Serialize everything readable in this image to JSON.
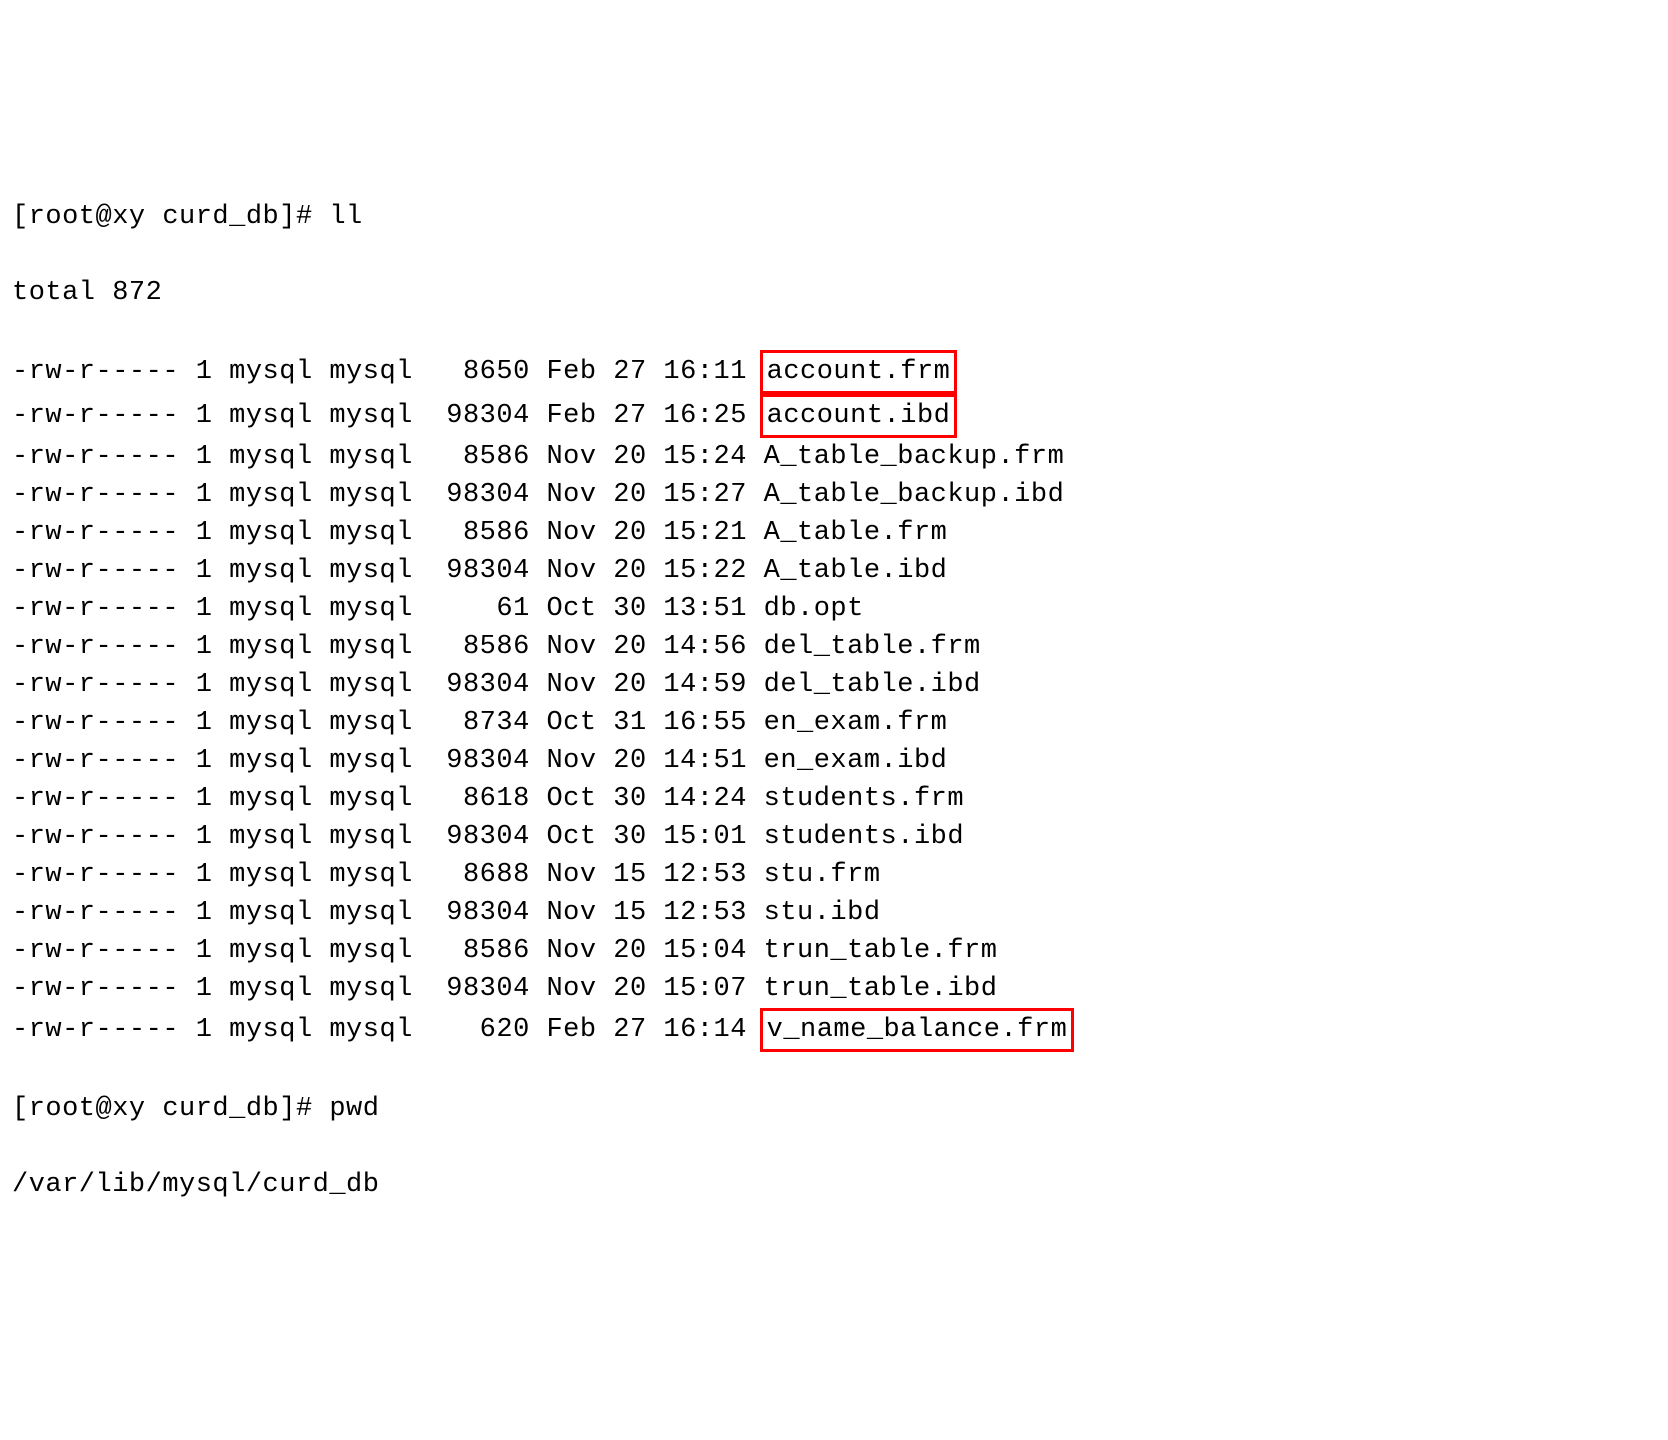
{
  "prompt1": "[root@xy curd_db]# ",
  "cmd1": "ll",
  "total_line": "total 872",
  "files": [
    {
      "perms": "-rw-r-----",
      "links": "1",
      "owner": "mysql",
      "group": "mysql",
      "size": "  8650",
      "date": "Feb 27 16:11",
      "name": "account.frm",
      "highlight": true
    },
    {
      "perms": "-rw-r-----",
      "links": "1",
      "owner": "mysql",
      "group": "mysql",
      "size": " 98304",
      "date": "Feb 27 16:25",
      "name": "account.ibd",
      "highlight": true
    },
    {
      "perms": "-rw-r-----",
      "links": "1",
      "owner": "mysql",
      "group": "mysql",
      "size": "  8586",
      "date": "Nov 20 15:24",
      "name": "A_table_backup.frm",
      "highlight": false
    },
    {
      "perms": "-rw-r-----",
      "links": "1",
      "owner": "mysql",
      "group": "mysql",
      "size": " 98304",
      "date": "Nov 20 15:27",
      "name": "A_table_backup.ibd",
      "highlight": false
    },
    {
      "perms": "-rw-r-----",
      "links": "1",
      "owner": "mysql",
      "group": "mysql",
      "size": "  8586",
      "date": "Nov 20 15:21",
      "name": "A_table.frm",
      "highlight": false
    },
    {
      "perms": "-rw-r-----",
      "links": "1",
      "owner": "mysql",
      "group": "mysql",
      "size": " 98304",
      "date": "Nov 20 15:22",
      "name": "A_table.ibd",
      "highlight": false
    },
    {
      "perms": "-rw-r-----",
      "links": "1",
      "owner": "mysql",
      "group": "mysql",
      "size": "    61",
      "date": "Oct 30 13:51",
      "name": "db.opt",
      "highlight": false
    },
    {
      "perms": "-rw-r-----",
      "links": "1",
      "owner": "mysql",
      "group": "mysql",
      "size": "  8586",
      "date": "Nov 20 14:56",
      "name": "del_table.frm",
      "highlight": false
    },
    {
      "perms": "-rw-r-----",
      "links": "1",
      "owner": "mysql",
      "group": "mysql",
      "size": " 98304",
      "date": "Nov 20 14:59",
      "name": "del_table.ibd",
      "highlight": false
    },
    {
      "perms": "-rw-r-----",
      "links": "1",
      "owner": "mysql",
      "group": "mysql",
      "size": "  8734",
      "date": "Oct 31 16:55",
      "name": "en_exam.frm",
      "highlight": false
    },
    {
      "perms": "-rw-r-----",
      "links": "1",
      "owner": "mysql",
      "group": "mysql",
      "size": " 98304",
      "date": "Nov 20 14:51",
      "name": "en_exam.ibd",
      "highlight": false
    },
    {
      "perms": "-rw-r-----",
      "links": "1",
      "owner": "mysql",
      "group": "mysql",
      "size": "  8618",
      "date": "Oct 30 14:24",
      "name": "students.frm",
      "highlight": false
    },
    {
      "perms": "-rw-r-----",
      "links": "1",
      "owner": "mysql",
      "group": "mysql",
      "size": " 98304",
      "date": "Oct 30 15:01",
      "name": "students.ibd",
      "highlight": false
    },
    {
      "perms": "-rw-r-----",
      "links": "1",
      "owner": "mysql",
      "group": "mysql",
      "size": "  8688",
      "date": "Nov 15 12:53",
      "name": "stu.frm",
      "highlight": false
    },
    {
      "perms": "-rw-r-----",
      "links": "1",
      "owner": "mysql",
      "group": "mysql",
      "size": " 98304",
      "date": "Nov 15 12:53",
      "name": "stu.ibd",
      "highlight": false
    },
    {
      "perms": "-rw-r-----",
      "links": "1",
      "owner": "mysql",
      "group": "mysql",
      "size": "  8586",
      "date": "Nov 20 15:04",
      "name": "trun_table.frm",
      "highlight": false
    },
    {
      "perms": "-rw-r-----",
      "links": "1",
      "owner": "mysql",
      "group": "mysql",
      "size": " 98304",
      "date": "Nov 20 15:07",
      "name": "trun_table.ibd",
      "highlight": false
    },
    {
      "perms": "-rw-r-----",
      "links": "1",
      "owner": "mysql",
      "group": "mysql",
      "size": "   620",
      "date": "Feb 27 16:14",
      "name": "v_name_balance.frm",
      "highlight": true
    }
  ],
  "prompt2": "[root@xy curd_db]# ",
  "cmd2": "pwd",
  "pwd_output": "/var/lib/mysql/curd_db"
}
